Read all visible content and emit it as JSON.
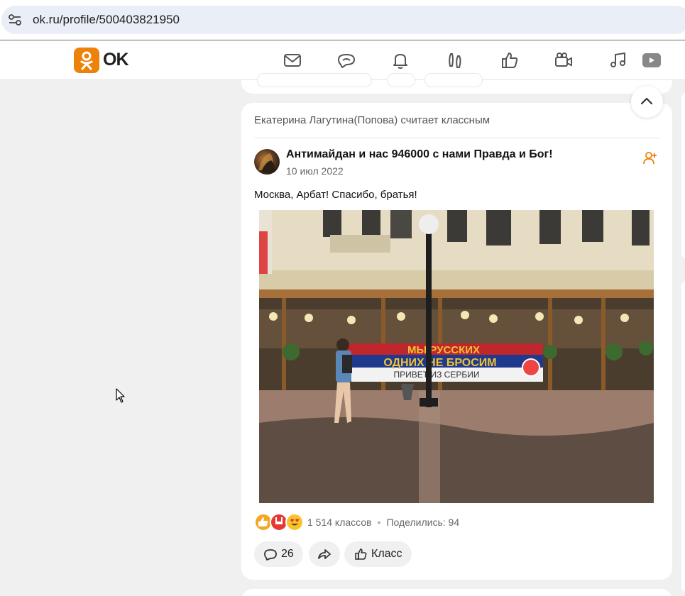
{
  "browser": {
    "url": "ok.ru/profile/500403821950"
  },
  "header": {
    "logo_text": "OK",
    "brand_color": "#ee8208",
    "nav_icons": [
      "mail-icon",
      "chat-icon",
      "bell-icon",
      "guests-icon",
      "like-icon",
      "video-camera-icon",
      "music-icon",
      "video-icon"
    ]
  },
  "post": {
    "activity_text": "Екатерина Лагутина(Попова) считает классным",
    "group_name": "Антимайдан и нас 946000 с нами Правда и Бог!",
    "date": "10 июл 2022",
    "text": "Москва, Арбат! Спасибо, братья!",
    "banner_line1": "МЫ РУССКИХ",
    "banner_line2": "ОДНИХ НЕ БРОСИМ",
    "banner_line3": "ПРИВЕТ ИЗ СЕРБИИ",
    "reactions": [
      "like-reaction-icon",
      "rock-reaction-icon",
      "heart-eyes-reaction-icon"
    ],
    "likes_count": "1 514 классов",
    "shares_label": "Поделились: 94",
    "comments_count": "26",
    "like_button_label": "Класс"
  }
}
